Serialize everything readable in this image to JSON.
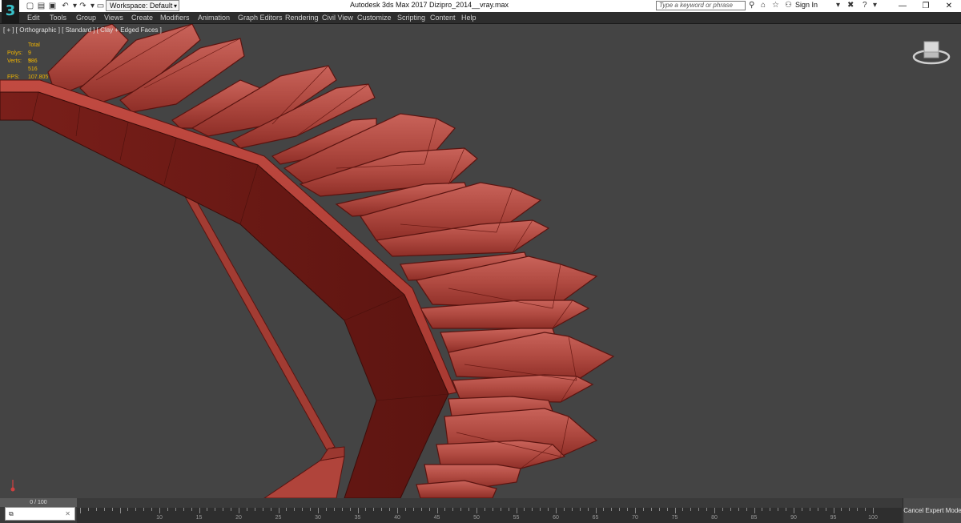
{
  "titlebar": {
    "logo": "3",
    "workspace_label": "Workspace: Default",
    "app_title": "Autodesk 3ds Max 2017    Dizipro_2014__vray.max",
    "search_placeholder": "Type a keyword or phrase",
    "signin_label": "Sign In",
    "min_glyph": "—",
    "restore_glyph": "❐",
    "close_glyph": "✕"
  },
  "menu": {
    "items": [
      "Edit",
      "Tools",
      "Group",
      "Views",
      "Create",
      "Modifiers",
      "Animation",
      "Graph Editors",
      "Rendering",
      "Civil View",
      "Customize",
      "Scripting",
      "Content",
      "Help"
    ]
  },
  "viewport": {
    "label": "[ + ] [ Orthographic ] [ Standard ] [ Clay + Edged Faces ]",
    "stats": {
      "total_label": "Total",
      "polys_label": "Polys:",
      "polys_value": "9 586",
      "verts_label": "Verts:",
      "verts_value": "9 516",
      "fps_label": "FPS:",
      "fps_value": "107.805"
    },
    "model_color": "#a83a32"
  },
  "bottom": {
    "frame_counter": "0 / 100",
    "maxscript_text": "",
    "cancel_expert_label": "Cancel Expert Mode",
    "tick_labels": [
      "10",
      "15",
      "20",
      "25",
      "30",
      "35",
      "40",
      "45",
      "50",
      "55",
      "60",
      "65",
      "70",
      "75",
      "80",
      "85",
      "90",
      "95",
      "100"
    ]
  },
  "colors": {
    "viewport_bg": "#444444",
    "stats_text": "#f0b400",
    "menubar_bg": "#2d2d2d"
  }
}
